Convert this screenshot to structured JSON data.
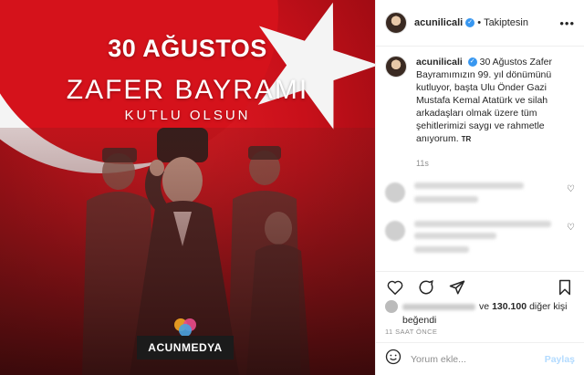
{
  "media": {
    "line1": "30 AĞUSTOS",
    "line2": "ZAFER BAYRAMI",
    "line3": "KUTLU OLSUN",
    "brand": "ACUNMEDYA"
  },
  "header": {
    "username": "acunilicali",
    "follow_label": "Takiptesin",
    "more_icon": "more-icon"
  },
  "caption": {
    "username": "acunilicali",
    "text": "30 Ağustos Zafer Bayramımızın 99. yıl dönümünü kutluyor, başta Ulu Önder Gazi Mustafa Kemal Atatürk ve silah arkadaşları olmak üzere tüm şehitlerimizi saygı ve rahmetle anıyorum.",
    "translate": "TR",
    "time": "11s"
  },
  "likes": {
    "suffix_pre": "ve",
    "count": "130.100",
    "suffix_post": "diğer kişi",
    "line2": "beğendi"
  },
  "timestamp": "11 SAAT ÖNCE",
  "comment_box": {
    "placeholder": "Yorum ekle...",
    "post_label": "Paylaş"
  },
  "colors": {
    "accent": "#3897f0",
    "flag_red": "#d5121b"
  }
}
